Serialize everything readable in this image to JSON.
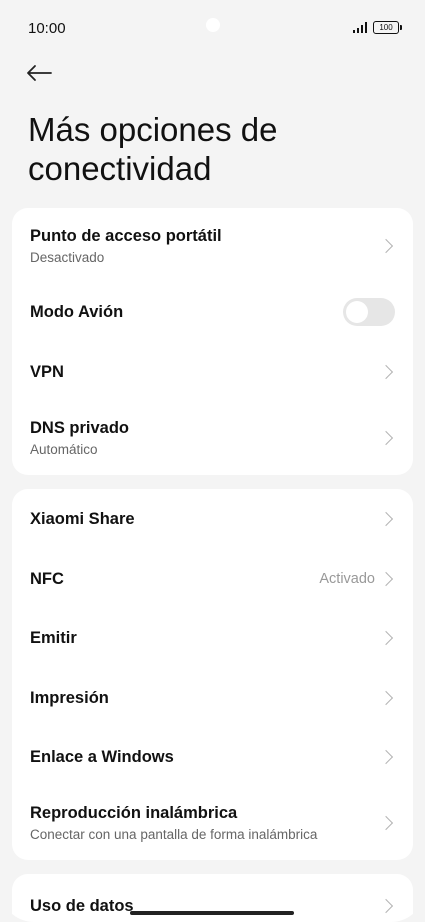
{
  "status": {
    "time": "10:00",
    "battery": "100"
  },
  "header": {
    "title": "Más opciones de conectividad"
  },
  "group1": [
    {
      "title": "Punto de acceso portátil",
      "subtitle": "Desactivado"
    },
    {
      "title": "Modo Avión",
      "toggle_state": "off"
    },
    {
      "title": "VPN"
    },
    {
      "title": "DNS privado",
      "subtitle": "Automático"
    }
  ],
  "group2": [
    {
      "title": "Xiaomi Share"
    },
    {
      "title": "NFC",
      "value": "Activado"
    },
    {
      "title": "Emitir"
    },
    {
      "title": "Impresión"
    },
    {
      "title": "Enlace a Windows"
    },
    {
      "title": "Reproducción inalámbrica",
      "subtitle": "Conectar con una pantalla de forma inalámbrica"
    }
  ],
  "group3": [
    {
      "title": "Uso de datos"
    }
  ],
  "icons": {
    "back": "arrow-left-icon",
    "chevron": "chevron-right-icon",
    "signal": "signal-icon",
    "battery": "battery-icon"
  }
}
